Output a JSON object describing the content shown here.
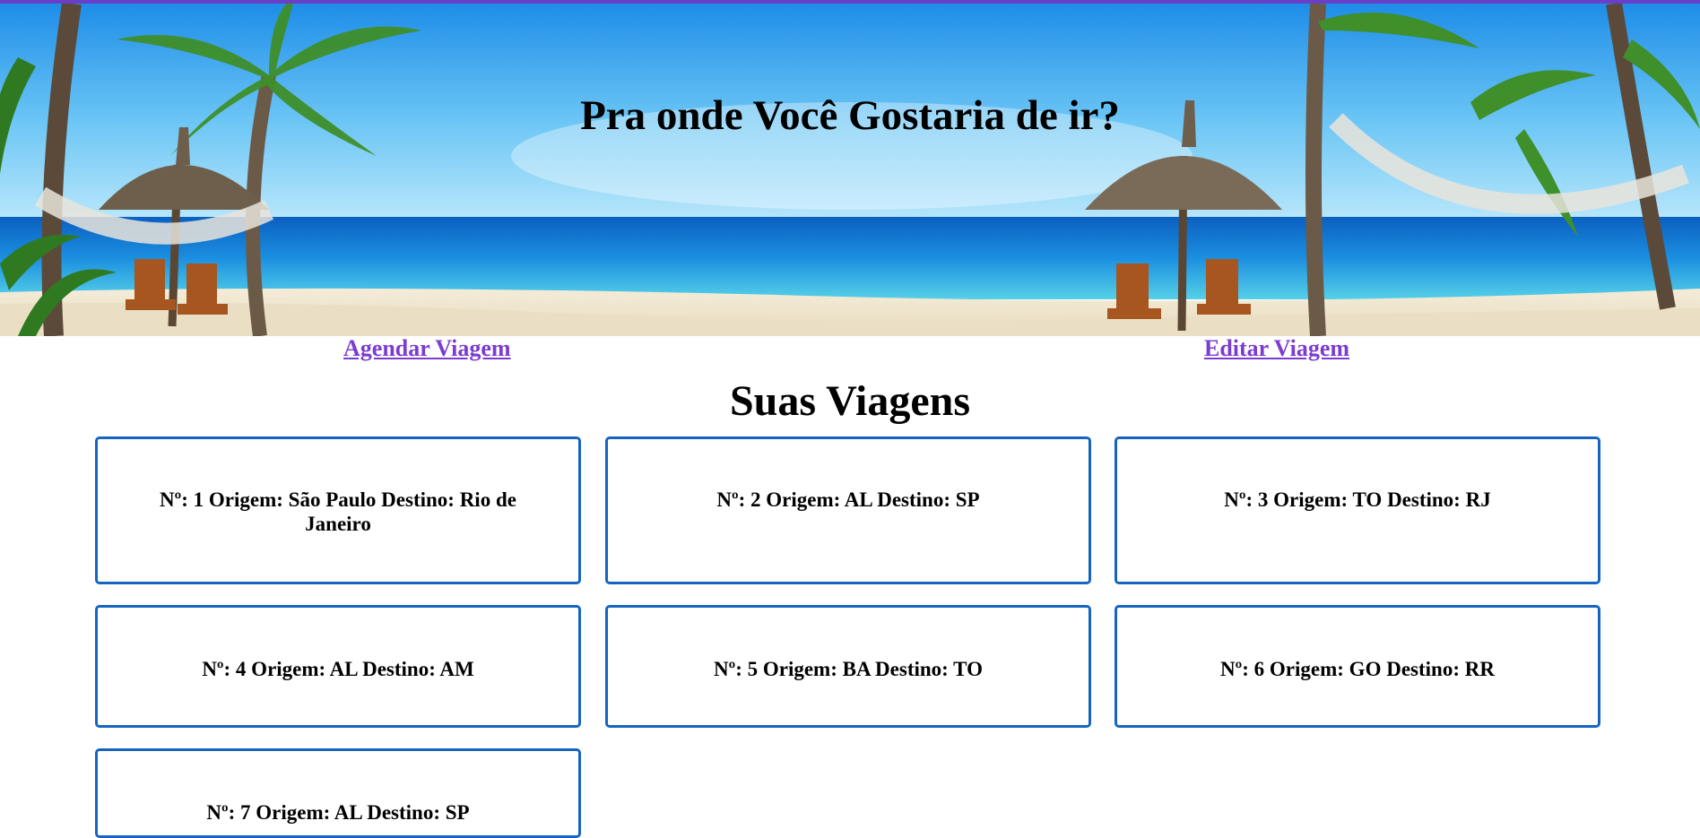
{
  "hero": {
    "title": "Pra onde Você Gostaria de ir?",
    "image": "tropical-beach-with-palm-trees-hammocks-umbrellas-and-chairs"
  },
  "nav": {
    "agendar_label": "Agendar Viagem",
    "editar_label": "Editar Viagem"
  },
  "section": {
    "title": "Suas Viagens"
  },
  "trips": [
    {
      "text": "Nº: 1 Origem: São Paulo Destino: Rio de Janeiro"
    },
    {
      "text": "Nº: 2 Origem: AL Destino: SP"
    },
    {
      "text": "Nº: 3 Origem: TO Destino: RJ"
    },
    {
      "text": "Nº: 4 Origem: AL Destino: AM"
    },
    {
      "text": "Nº: 5 Origem: BA Destino: TO"
    },
    {
      "text": "Nº: 6 Origem: GO Destino: RR"
    },
    {
      "text": "Nº: 7 Origem: AL Destino: SP"
    }
  ],
  "colors": {
    "accent_strip": "#6a3fc7",
    "link": "#7b3ccf",
    "card_border": "#1565c0"
  }
}
